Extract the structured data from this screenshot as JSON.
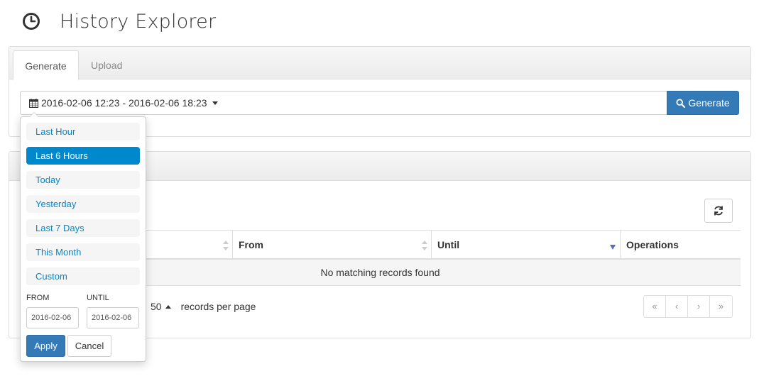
{
  "header": {
    "title": "History Explorer",
    "icon": "clock-icon"
  },
  "tabs": [
    {
      "label": "Generate",
      "active": true
    },
    {
      "label": "Upload",
      "active": false
    }
  ],
  "range_picker": {
    "value": "2016-02-06 12:23 - 2016-02-06 18:23",
    "icon": "calendar-icon",
    "generate_label": "Generate",
    "generate_icon": "search-icon",
    "ranges": [
      "Last Hour",
      "Last 6 Hours",
      "Today",
      "Yesterday",
      "Last 7 Days",
      "This Month",
      "Custom"
    ],
    "active_range": "Last 6 Hours",
    "from_label": "FROM",
    "until_label": "UNTIL",
    "from_value": "2016-02-06",
    "until_value": "2016-02-06",
    "apply_label": "Apply",
    "cancel_label": "Cancel"
  },
  "table": {
    "columns": [
      "",
      "From",
      "Until",
      "Operations"
    ],
    "sorted_column": "Until",
    "sort_direction": "desc",
    "empty_message": "No matching records found"
  },
  "pagination": {
    "page_size": "50",
    "records_label": "records per page",
    "buttons": [
      "«",
      "‹",
      "›",
      "»"
    ]
  },
  "colors": {
    "primary": "#337ab7",
    "range_active": "#0088cc",
    "link": "#0088cc"
  }
}
